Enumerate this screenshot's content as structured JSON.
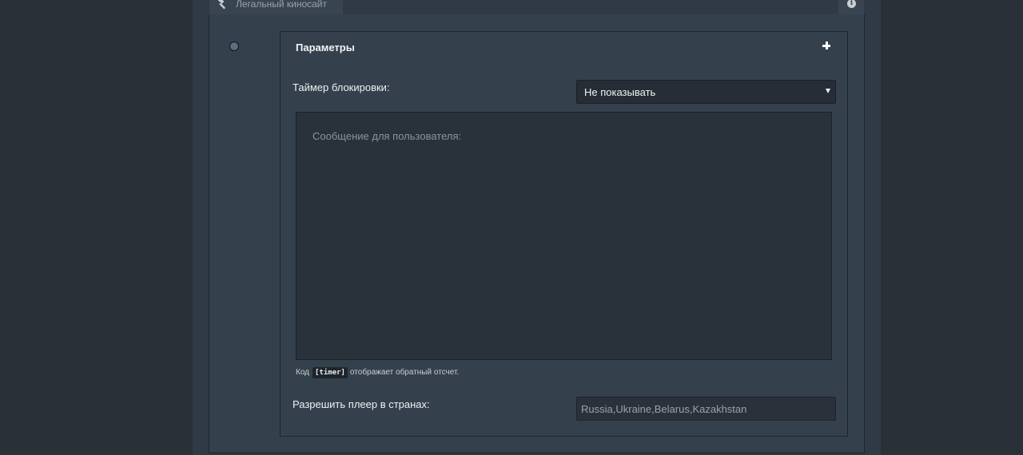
{
  "header": {
    "tab_title": "Легальный киносайт",
    "tab_icon": "hammer-icon",
    "info_icon": "info-icon",
    "info_glyph": "i"
  },
  "params": {
    "title": "Параметры",
    "expand_icon": "plus-icon"
  },
  "block_timer": {
    "label": "Таймер блокировки:",
    "selected": "Не показывать"
  },
  "message": {
    "placeholder": "Сообщение для пользователя:"
  },
  "hint": {
    "prefix": "Код",
    "code": "[timer]",
    "suffix": "отображает обратный отсчет."
  },
  "countries": {
    "label": "Разрешить плеер в странах:",
    "value": "Russia,Ukraine,Belarus,Kazakhstan"
  },
  "colors": {
    "page_bg": "#293038",
    "panel_bg": "#34414c",
    "input_bg": "#262d36",
    "accent_dot": "#5b6f83"
  }
}
